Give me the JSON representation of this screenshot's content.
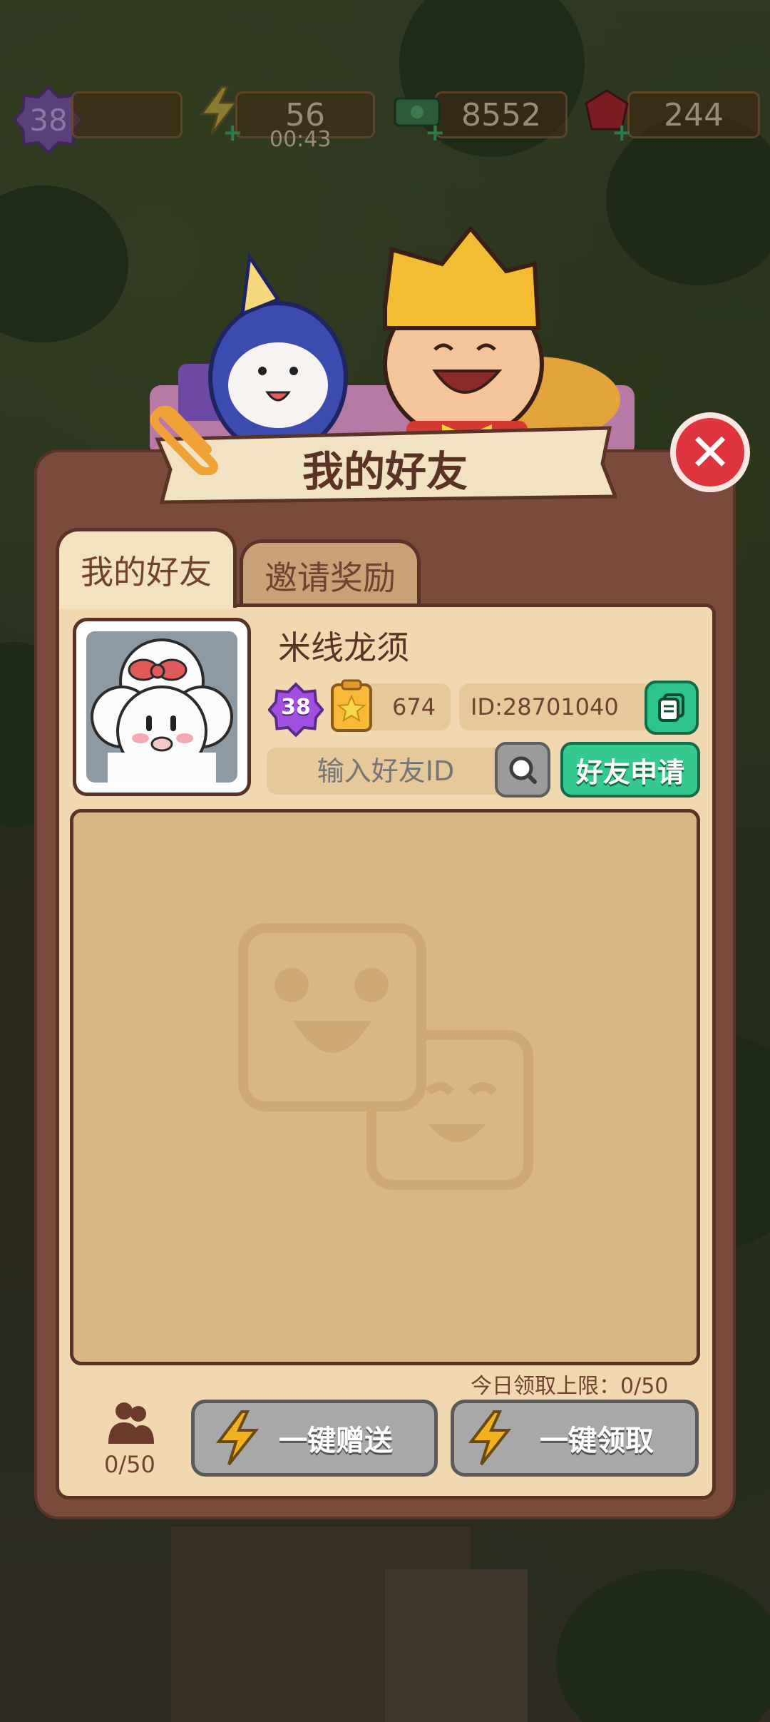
{
  "top_bar": {
    "level": "38",
    "energy": "56",
    "energy_timer": "00:43",
    "cash": "8552",
    "gems": "244"
  },
  "panel": {
    "title": "我的好友",
    "tabs": [
      {
        "label": "我的好友",
        "active": true
      },
      {
        "label": "邀请奖励",
        "active": false
      }
    ]
  },
  "profile": {
    "nickname": "米线龙须",
    "level": "38",
    "stars": "674",
    "id_text": "ID:28701040"
  },
  "search": {
    "placeholder": "输入好友ID",
    "apply_label": "好友申请"
  },
  "footer": {
    "daily_limit": "今日领取上限：0/50",
    "friend_count": "0/50",
    "send_all_label": "一键赠送",
    "claim_all_label": "一键领取"
  },
  "colors": {
    "panel_brown": "#7a4b3c",
    "cream": "#f0d9b1",
    "green_button": "#36c98f",
    "close_red": "#e0343e"
  }
}
